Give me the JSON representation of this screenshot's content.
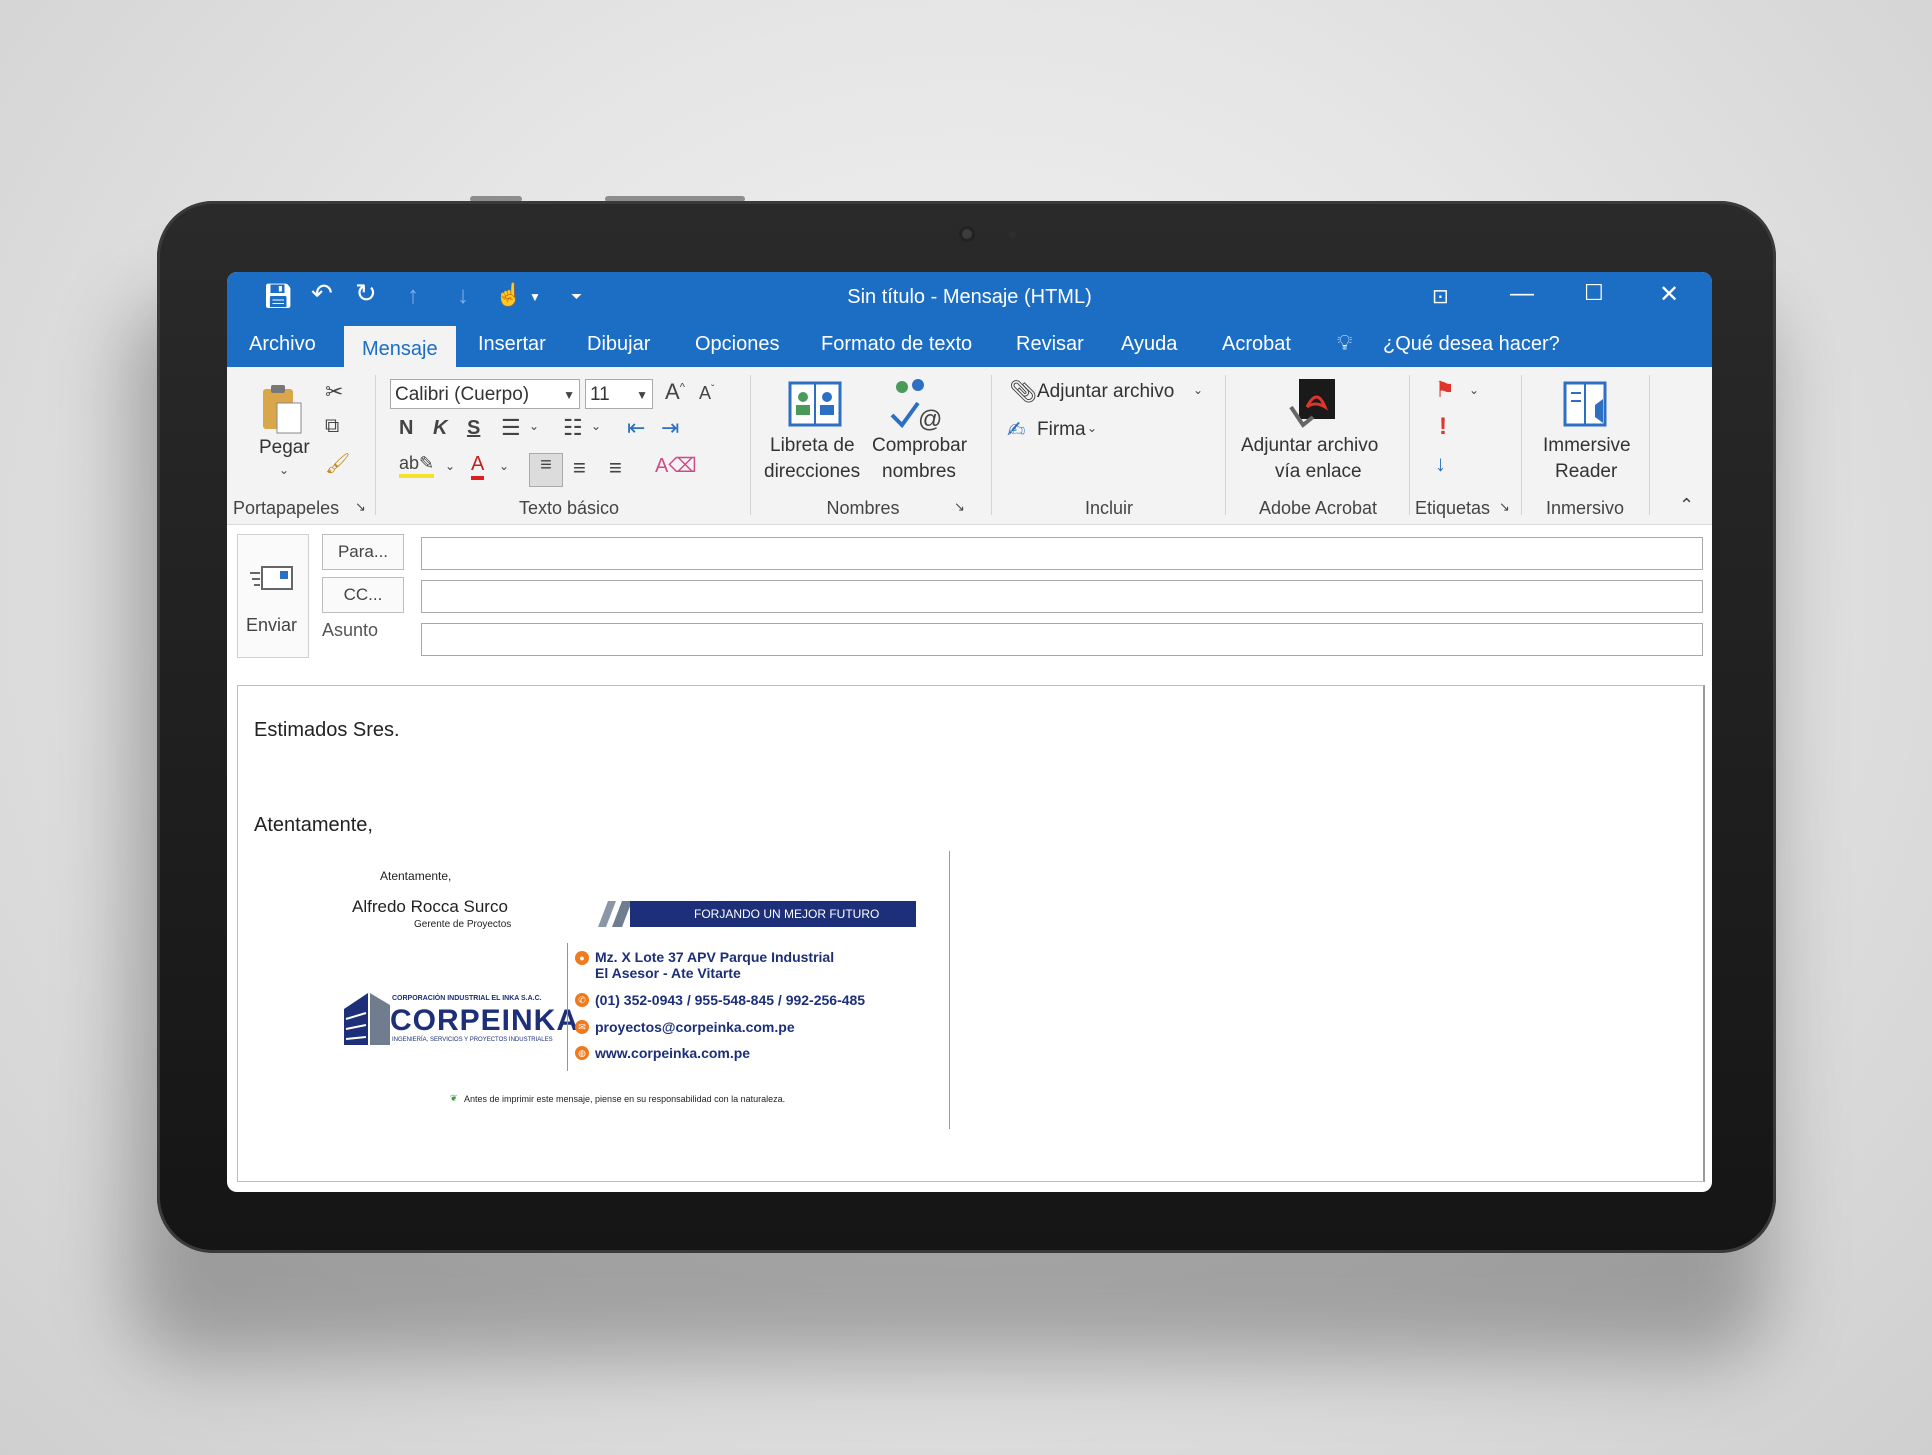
{
  "window": {
    "title": "Sin título  -  Mensaje (HTML)"
  },
  "tabs": [
    "Archivo",
    "Mensaje",
    "Insertar",
    "Dibujar",
    "Opciones",
    "Formato de texto",
    "Revisar",
    "Ayuda",
    "Acrobat"
  ],
  "tell_me": "¿Qué desea hacer?",
  "ribbon": {
    "clipboard": {
      "paste": "Pegar",
      "label": "Portapapeles"
    },
    "text": {
      "font": "Calibri (Cuerpo)",
      "size": "11",
      "bold": "N",
      "italic": "K",
      "underline": "S",
      "label": "Texto básico"
    },
    "names": {
      "address_book_1": "Libreta de",
      "address_book_2": "direcciones",
      "check_names_1": "Comprobar",
      "check_names_2": "nombres",
      "label": "Nombres"
    },
    "include": {
      "attach": "Adjuntar archivo",
      "signature": "Firma",
      "label": "Incluir"
    },
    "acrobat": {
      "attach_link_1": "Adjuntar archivo",
      "attach_link_2": "vía enlace",
      "label": "Adobe Acrobat"
    },
    "tags": {
      "label": "Etiquetas"
    },
    "immersive": {
      "reader_1": "Immersive",
      "reader_2": "Reader",
      "label": "Inmersivo"
    }
  },
  "compose": {
    "send": "Enviar",
    "to": "Para...",
    "cc": "CC...",
    "subject": "Asunto",
    "to_value": "",
    "cc_value": "",
    "subject_value": ""
  },
  "message": {
    "greeting": "Estimados Sres.",
    "closing": "Atentamente,"
  },
  "signature": {
    "salutation": "Atentamente,",
    "name": "Alfredo Rocca Surco",
    "role": "Gerente de Proyectos",
    "banner": "FORJANDO UN MEJOR FUTURO",
    "company_top": "CORPORACIÓN INDUSTRIAL EL INKA S.A.C.",
    "brand": "CORPEINKA",
    "company_sub": "INGENIERÍA, SERVICIOS Y PROYECTOS INDUSTRIALES",
    "address_1": "Mz. X Lote 37 APV Parque Industrial",
    "address_2": "El Asesor - Ate Vitarte",
    "phones": "(01) 352-0943 / 955-548-845 / 992-256-485",
    "email": "proyectos@corpeinka.com.pe",
    "web": "www.corpeinka.com.pe",
    "eco_note": "Antes de imprimir este mensaje, piense en su responsabilidad con la naturaleza.",
    "colors": {
      "navy": "#1c2f78",
      "orange": "#f07a1e",
      "steel": "#6f7d8f"
    }
  },
  "colors": {
    "accent": "#1c6dc4",
    "ribbon": "#f3f3f3"
  }
}
